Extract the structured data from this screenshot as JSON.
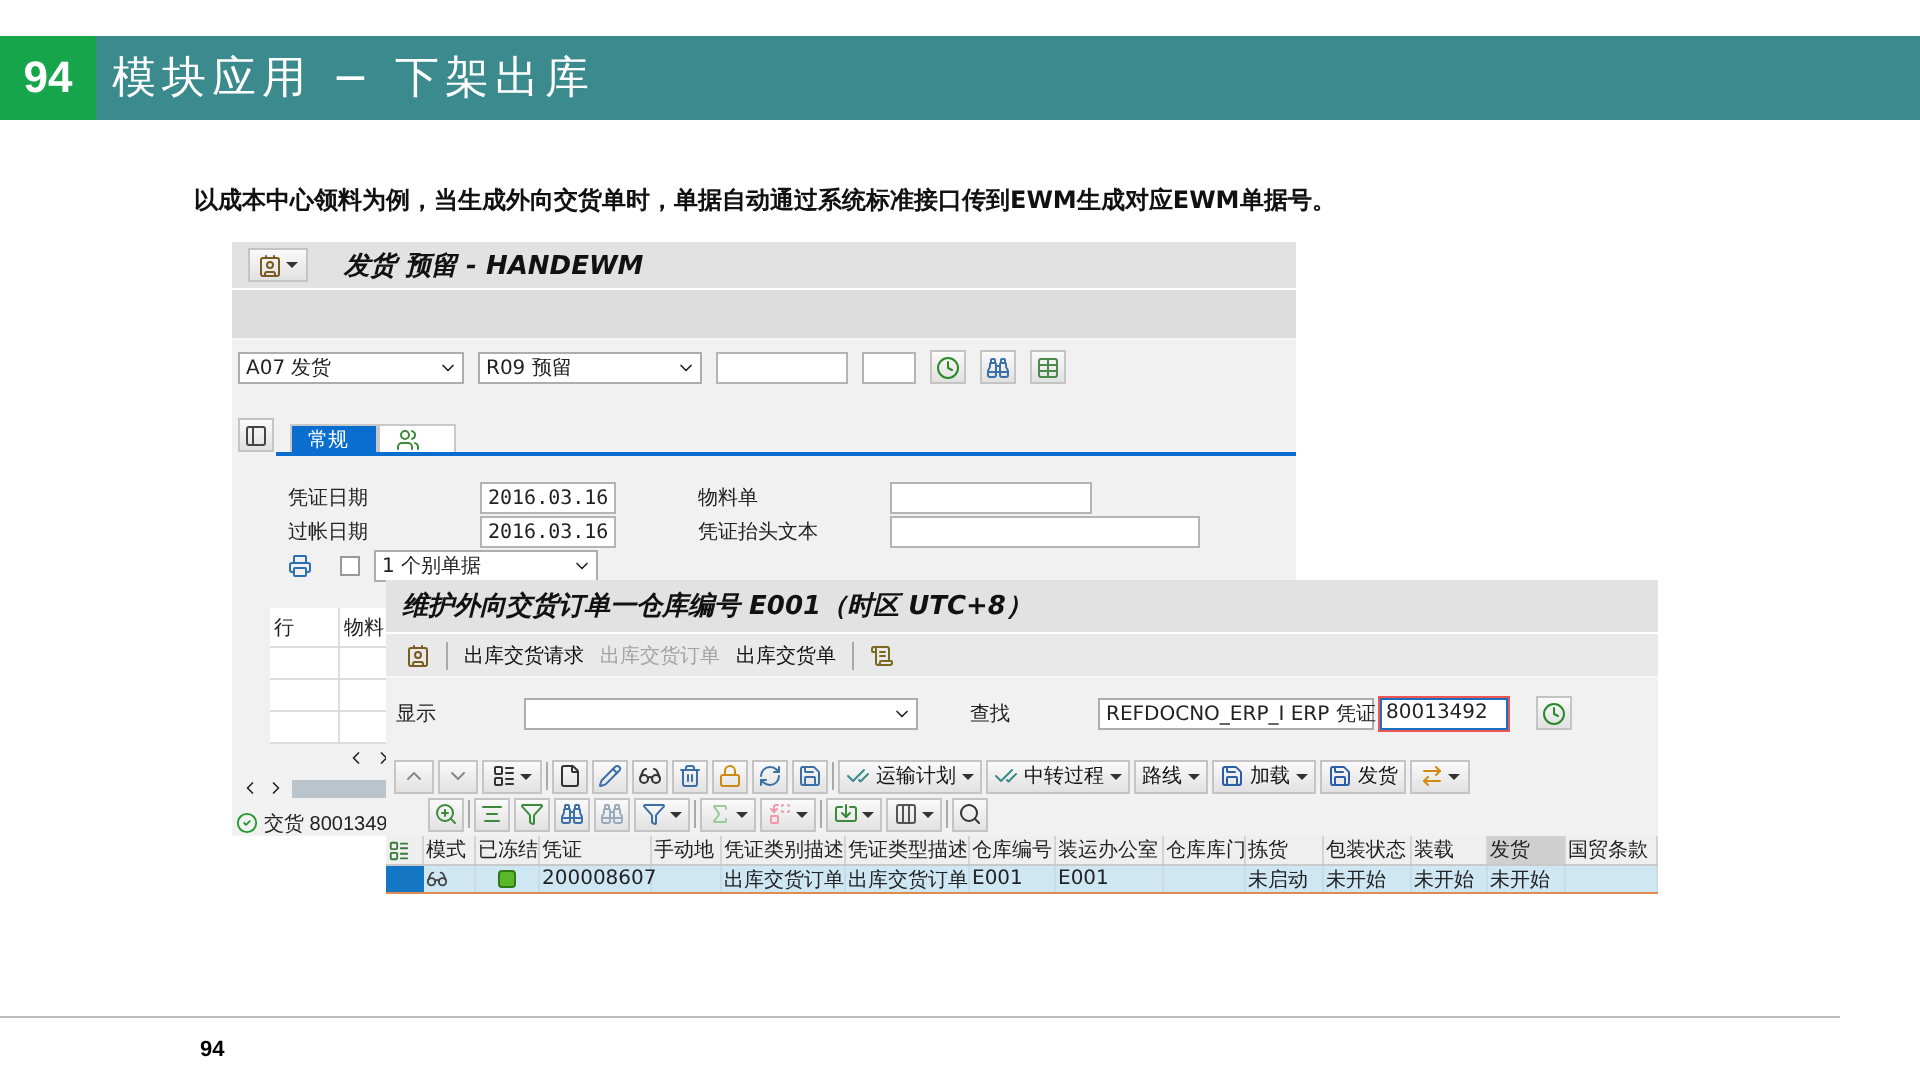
{
  "slide": {
    "number": "94",
    "title": "模块应用 − 下架出库",
    "subtitle": "以成本中心领料为例，当生成外向交货单时，单据自动通过系统标准接口传到EWM生成对应EWM单据号。",
    "page_number": "94"
  },
  "goods_movement_window": {
    "title": "发货 预留 - HANDEWM",
    "transaction": "A07 发货",
    "reference": "R09 预留",
    "tabs": [
      {
        "kind": "text",
        "label": "常规",
        "selected": true
      },
      {
        "kind": "icon",
        "selected": false
      }
    ],
    "date_fields": [
      {
        "label": "凭证日期",
        "value": "2016.03.16"
      },
      {
        "label": "过帐日期",
        "value": "2016.03.16"
      }
    ],
    "text_fields": [
      {
        "label": "物料单"
      },
      {
        "label": "凭证抬头文本"
      }
    ],
    "print_checkbox": {
      "checked": false
    },
    "print_option": "1 个别单据",
    "table_columns": [
      "行",
      "物料"
    ],
    "status_message": "交货 8001349"
  },
  "delivery_window": {
    "title": "维护外向交货订单一仓库编号 E001（时区 UTC+8）",
    "menu": [
      {
        "label": "出库交货请求",
        "disabled": false
      },
      {
        "label": "出库交货订单",
        "disabled": true
      },
      {
        "label": "出库交货单",
        "disabled": false
      }
    ],
    "display_label": "显示",
    "find_label": "查找",
    "find_field": "REFDOCNO_ERP_I ERP 凭证",
    "find_value": "80013492",
    "actions": [
      {
        "label": "运输计划",
        "dropdown": true
      },
      {
        "label": "中转过程",
        "dropdown": true
      },
      {
        "label": "路线",
        "dropdown": true
      },
      {
        "label": "加载",
        "dropdown": true
      },
      {
        "label": "发货",
        "dropdown": false
      }
    ],
    "columns": [
      {
        "label": "模式",
        "selected": false
      },
      {
        "label": "已冻结",
        "selected": false
      },
      {
        "label": "凭证",
        "selected": false
      },
      {
        "label": "手动地",
        "selected": false
      },
      {
        "label": "凭证类别描述",
        "selected": false
      },
      {
        "label": "凭证类型描述",
        "selected": false
      },
      {
        "label": "仓库编号",
        "selected": false
      },
      {
        "label": "装运办公室",
        "selected": false
      },
      {
        "label": "仓库库门",
        "selected": false
      },
      {
        "label": "拣货",
        "selected": false
      },
      {
        "label": "包装状态",
        "selected": false
      },
      {
        "label": "装载",
        "selected": false
      },
      {
        "label": "发货",
        "selected": true
      },
      {
        "label": "国贸条款",
        "selected": false
      }
    ],
    "rows": [
      {
        "selected": true,
        "document": "200008607",
        "category_desc": "出库交货订单",
        "type_desc": "出库交货订单",
        "warehouse": "E001",
        "shipping_office": "E001",
        "picking": "未启动",
        "packing": "未开始",
        "loading": "未开始",
        "goods_issue": "未开始"
      }
    ]
  }
}
